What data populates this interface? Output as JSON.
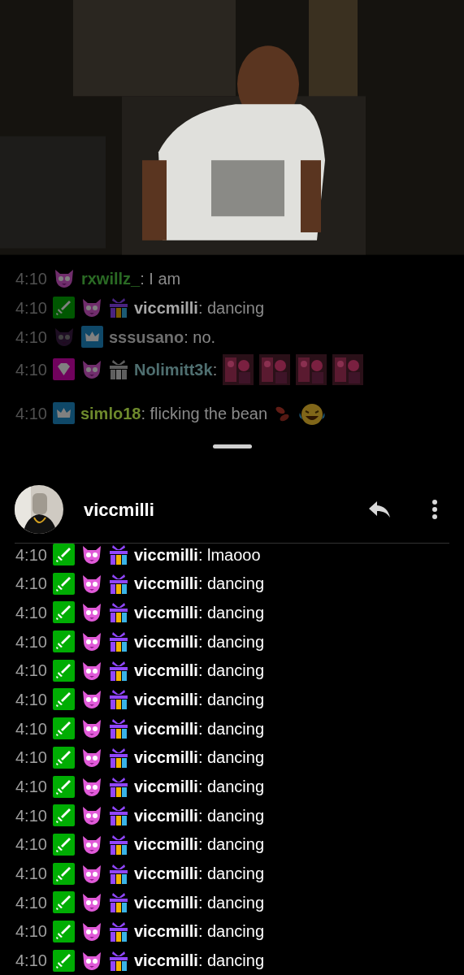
{
  "video": {
    "kind": "picture"
  },
  "overlay_chat": {
    "messages": [
      {
        "time": "4:10",
        "badges": [
          {
            "kind": "sub"
          }
        ],
        "user": "rxwillz_",
        "color": "#2a6a24",
        "text": ": I am"
      },
      {
        "time": "4:10",
        "badges": [
          {
            "kind": "mod"
          },
          {
            "kind": "sub"
          },
          {
            "kind": "gift"
          }
        ],
        "user": "viccmilli",
        "color": "#a8a8a8",
        "text": ": dancing"
      },
      {
        "time": "4:10",
        "badges": [
          {
            "kind": "sub_dark"
          },
          {
            "kind": "prime"
          }
        ],
        "user": "sssusano",
        "color": "#6e6e6e",
        "text": ": no."
      },
      {
        "time": "4:10",
        "badges": [
          {
            "kind": "vip"
          },
          {
            "kind": "sub"
          },
          {
            "kind": "gift_grey"
          }
        ],
        "user": "Nolimitt3k",
        "color": "#4f6f70",
        "text": ":",
        "emotes": [
          {
            "kind": "picture"
          },
          {
            "kind": "picture"
          },
          {
            "kind": "picture"
          },
          {
            "kind": "picture"
          }
        ]
      },
      {
        "time": "4:10",
        "badges": [
          {
            "kind": "prime"
          }
        ],
        "user": "simlo18",
        "color": "#6e8a2c",
        "text": ": flicking the bean",
        "emotes": [
          {
            "kind": "bean"
          },
          {
            "kind": "laughing"
          }
        ]
      }
    ]
  },
  "sheet": {
    "user": {
      "name": "viccmilli",
      "avatar": {
        "kind": "picture"
      }
    },
    "messages": [
      {
        "time": "4:10",
        "badges": [
          {
            "kind": "mod"
          },
          {
            "kind": "sub"
          },
          {
            "kind": "gift"
          }
        ],
        "user": "viccmilli",
        "text": ": lmaooo"
      },
      {
        "time": "4:10",
        "badges": [
          {
            "kind": "mod"
          },
          {
            "kind": "sub"
          },
          {
            "kind": "gift"
          }
        ],
        "user": "viccmilli",
        "text": ": dancing"
      },
      {
        "time": "4:10",
        "badges": [
          {
            "kind": "mod"
          },
          {
            "kind": "sub"
          },
          {
            "kind": "gift"
          }
        ],
        "user": "viccmilli",
        "text": ": dancing"
      },
      {
        "time": "4:10",
        "badges": [
          {
            "kind": "mod"
          },
          {
            "kind": "sub"
          },
          {
            "kind": "gift"
          }
        ],
        "user": "viccmilli",
        "text": ": dancing"
      },
      {
        "time": "4:10",
        "badges": [
          {
            "kind": "mod"
          },
          {
            "kind": "sub"
          },
          {
            "kind": "gift"
          }
        ],
        "user": "viccmilli",
        "text": ": dancing"
      },
      {
        "time": "4:10",
        "badges": [
          {
            "kind": "mod"
          },
          {
            "kind": "sub"
          },
          {
            "kind": "gift"
          }
        ],
        "user": "viccmilli",
        "text": ": dancing"
      },
      {
        "time": "4:10",
        "badges": [
          {
            "kind": "mod"
          },
          {
            "kind": "sub"
          },
          {
            "kind": "gift"
          }
        ],
        "user": "viccmilli",
        "text": ": dancing"
      },
      {
        "time": "4:10",
        "badges": [
          {
            "kind": "mod"
          },
          {
            "kind": "sub"
          },
          {
            "kind": "gift"
          }
        ],
        "user": "viccmilli",
        "text": ": dancing"
      },
      {
        "time": "4:10",
        "badges": [
          {
            "kind": "mod"
          },
          {
            "kind": "sub"
          },
          {
            "kind": "gift"
          }
        ],
        "user": "viccmilli",
        "text": ": dancing"
      },
      {
        "time": "4:10",
        "badges": [
          {
            "kind": "mod"
          },
          {
            "kind": "sub"
          },
          {
            "kind": "gift"
          }
        ],
        "user": "viccmilli",
        "text": ": dancing"
      },
      {
        "time": "4:10",
        "badges": [
          {
            "kind": "mod"
          },
          {
            "kind": "sub"
          },
          {
            "kind": "gift"
          }
        ],
        "user": "viccmilli",
        "text": ": dancing"
      },
      {
        "time": "4:10",
        "badges": [
          {
            "kind": "mod"
          },
          {
            "kind": "sub"
          },
          {
            "kind": "gift"
          }
        ],
        "user": "viccmilli",
        "text": ": dancing"
      },
      {
        "time": "4:10",
        "badges": [
          {
            "kind": "mod"
          },
          {
            "kind": "sub"
          },
          {
            "kind": "gift"
          }
        ],
        "user": "viccmilli",
        "text": ": dancing"
      },
      {
        "time": "4:10",
        "badges": [
          {
            "kind": "mod"
          },
          {
            "kind": "sub"
          },
          {
            "kind": "gift"
          }
        ],
        "user": "viccmilli",
        "text": ": dancing"
      },
      {
        "time": "4:10",
        "badges": [
          {
            "kind": "mod"
          },
          {
            "kind": "sub"
          },
          {
            "kind": "gift"
          }
        ],
        "user": "viccmilli",
        "text": ": dancing"
      }
    ]
  }
}
